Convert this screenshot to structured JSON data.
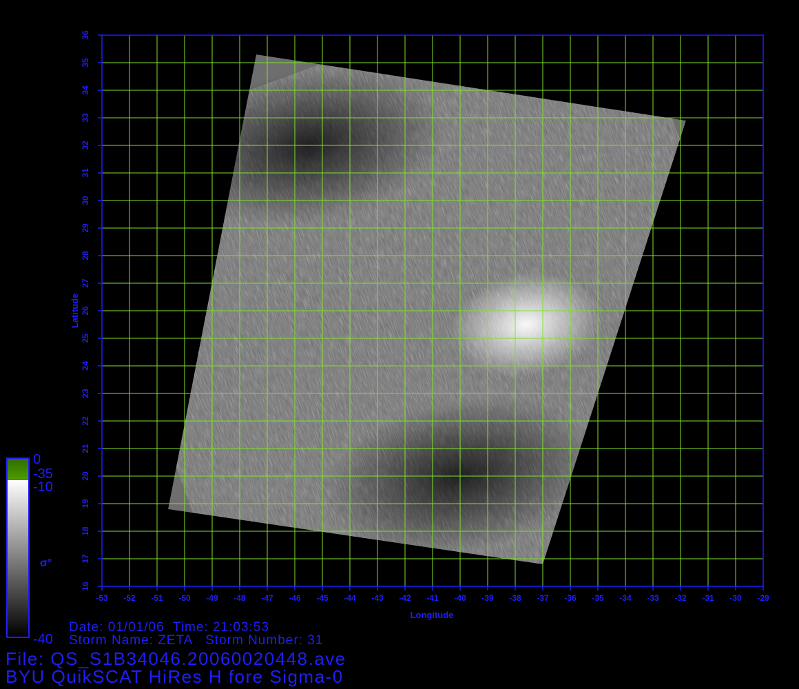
{
  "chart_data": {
    "type": "heatmap",
    "xlabel": "Longitude",
    "ylabel": "Latitude",
    "xlim": [
      -53,
      -29
    ],
    "ylim": [
      16,
      36
    ],
    "x_ticks": [
      "-53",
      "-52",
      "-51",
      "-50",
      "-49",
      "-48",
      "-47",
      "-46",
      "-45",
      "-44",
      "-43",
      "-42",
      "-41",
      "-40",
      "-39",
      "-38",
      "-37",
      "-36",
      "-35",
      "-34",
      "-33",
      "-32",
      "-31",
      "-30",
      "-29"
    ],
    "y_ticks": [
      "16",
      "17",
      "18",
      "19",
      "20",
      "21",
      "22",
      "23",
      "24",
      "25",
      "26",
      "27",
      "28",
      "29",
      "30",
      "31",
      "32",
      "33",
      "34",
      "35",
      "36"
    ],
    "grid": true,
    "swath_corners": [
      {
        "lon": -47.4,
        "lat": 35.3
      },
      {
        "lon": -31.8,
        "lat": 32.9
      },
      {
        "lon": -37.0,
        "lat": 16.8
      },
      {
        "lon": -50.6,
        "lat": 18.8
      }
    ],
    "features": [
      {
        "label": "bright",
        "lon": -37.6,
        "lat": 25.5
      },
      {
        "label": "dark",
        "lon": -45.5,
        "lat": 32.0
      },
      {
        "label": "dark",
        "lon": -40.0,
        "lat": 20.0
      }
    ],
    "colorbar": {
      "title": "σ°",
      "ticks": [
        "0",
        "-35",
        "-10",
        "-40"
      ],
      "green_range": [
        -35,
        0
      ],
      "gray_range": [
        -40,
        -10
      ]
    },
    "colors": {
      "grid": "#7fe12d",
      "axes": "#1e1eff",
      "background": "#000000"
    }
  },
  "footer": {
    "date_line": "Date: 01/01/06  Time: 21:03:53",
    "storm_line": "Storm Name: ZETA   Storm Number: 31",
    "file_line": "File: QS_S1B34046.20060020448.ave",
    "product_line": "BYU QuikSCAT HiRes H fore Sigma-0"
  }
}
